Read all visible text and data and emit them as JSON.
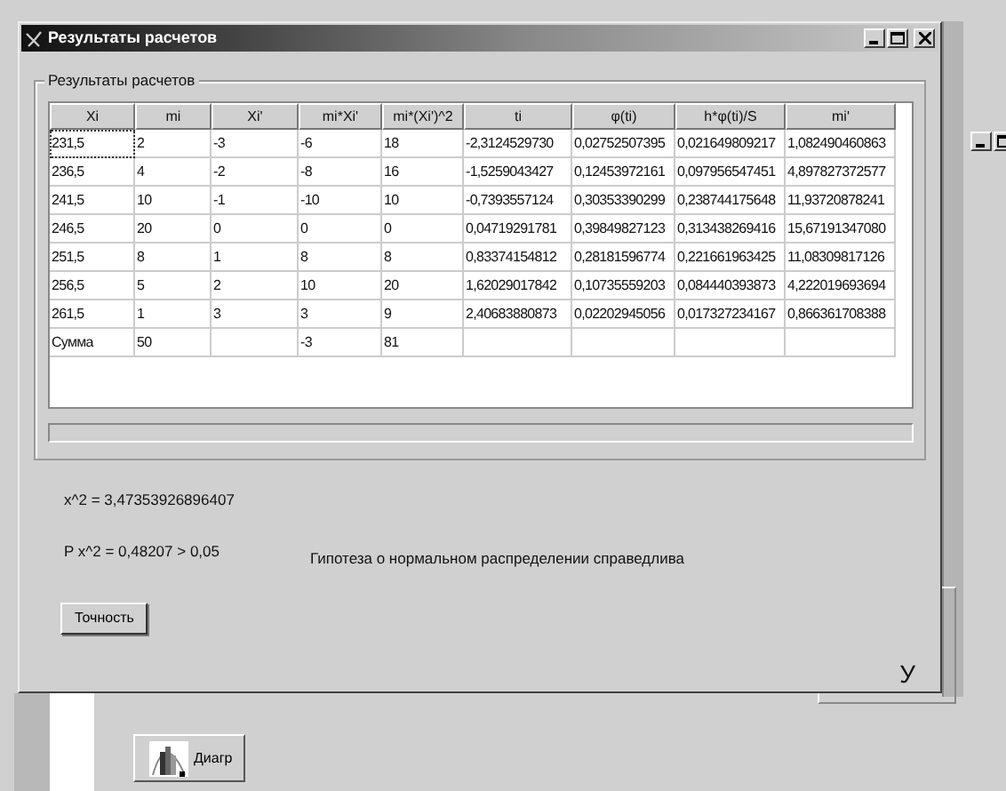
{
  "window": {
    "title": "Результаты расчетов"
  },
  "group": {
    "title": "Результаты расчетов"
  },
  "table": {
    "columns": [
      "Xi",
      "mi",
      "Xi'",
      "mi*Xi'",
      "mi*(Xi')^2",
      "ti",
      "φ(ti)",
      "h*φ(ti)/S",
      "mi'"
    ],
    "rows": [
      {
        "focused": true,
        "cells": [
          "231,5",
          "2",
          "-3",
          "-6",
          "18",
          "-2,3124529730",
          "0,02752507395",
          "0,021649809217",
          "1,082490460863"
        ]
      },
      {
        "focused": false,
        "cells": [
          "236,5",
          "4",
          "-2",
          "-8",
          "16",
          "-1,5259043427",
          "0,12453972161",
          "0,097956547451",
          "4,897827372577"
        ]
      },
      {
        "focused": false,
        "cells": [
          "241,5",
          "10",
          "-1",
          "-10",
          "10",
          "-0,7393557124",
          "0,30353390299",
          "0,238744175648",
          "11,93720878241"
        ]
      },
      {
        "focused": false,
        "cells": [
          "246,5",
          "20",
          "0",
          "0",
          "0",
          "0,04719291781",
          "0,39849827123",
          "0,313438269416",
          "15,67191347080"
        ]
      },
      {
        "focused": false,
        "cells": [
          "251,5",
          "8",
          "1",
          "8",
          "8",
          "0,83374154812",
          "0,28181596774",
          "0,221661963425",
          "11,08309817126"
        ]
      },
      {
        "focused": false,
        "cells": [
          "256,5",
          "5",
          "2",
          "10",
          "20",
          "1,62029017842",
          "0,10735559203",
          "0,084440393873",
          "4,222019693694"
        ]
      },
      {
        "focused": false,
        "cells": [
          "261,5",
          "1",
          "3",
          "3",
          "9",
          "2,40683880873",
          "0,02202945056",
          "0,017327234167",
          "0,866361708388"
        ]
      },
      {
        "focused": false,
        "cells": [
          "Сумма",
          "50",
          "",
          "-3",
          "81",
          "",
          "",
          "",
          ""
        ]
      }
    ]
  },
  "results": {
    "chi_square": "x^2 = 3,47353926896407",
    "probability": "P x^2 = 0,48207 > 0,05",
    "conclusion": "Гипотеза о нормальном распределении справедлива"
  },
  "button": {
    "label": "Точность"
  },
  "corner_label": "У",
  "background_window": {
    "button": {
      "label": "Диагр"
    }
  }
}
